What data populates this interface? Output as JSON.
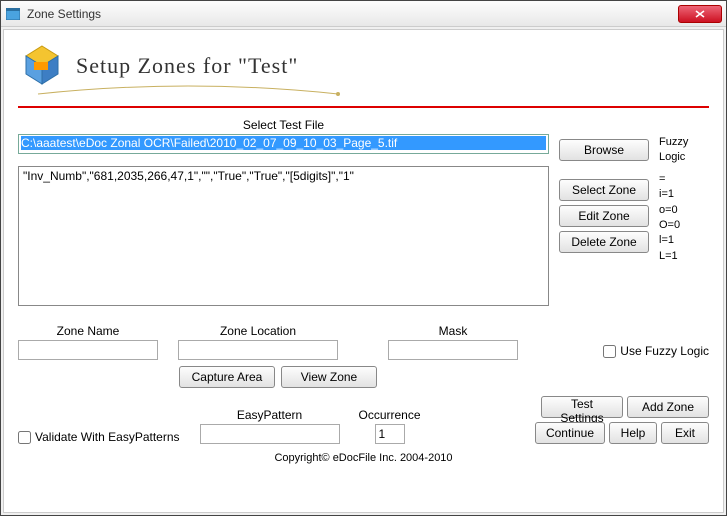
{
  "window": {
    "title": "Zone  Settings"
  },
  "header": {
    "title": "Setup Zones for \"Test\""
  },
  "file": {
    "label": "Select Test File",
    "path": "C:\\aaatest\\eDoc Zonal OCR\\Failed\\2010_02_07_09_10_03_Page_5.tif",
    "browse": "Browse"
  },
  "zone_buttons": {
    "select": "Select Zone",
    "edit": "Edit Zone",
    "delete": "Delete Zone"
  },
  "fuzzy": {
    "title": "Fuzzy Logic",
    "lines": "=\ni=1\no=0\nO=0\nl=1\nL=1"
  },
  "zone_list_text": "\"Inv_Numb\",\"681,2035,266,47,1\",\"\",\"True\",\"True\",\"[5digits]\",\"1\"",
  "fields": {
    "zone_name_label": "Zone Name",
    "zone_location_label": "Zone Location",
    "mask_label": "Mask",
    "use_fuzzy_label": "Use Fuzzy Logic",
    "capture_area": "Capture Area",
    "view_zone": "View Zone",
    "validate_label": "Validate With EasyPatterns",
    "easypattern_label": "EasyPattern",
    "occurrence_label": "Occurrence",
    "occurrence_value": "1"
  },
  "footer": {
    "test_settings": "Test Settings",
    "add_zone": "Add Zone",
    "continue": "Continue",
    "help": "Help",
    "exit": "Exit"
  },
  "copyright": "Copyright© eDocFile Inc. 2004-2010"
}
